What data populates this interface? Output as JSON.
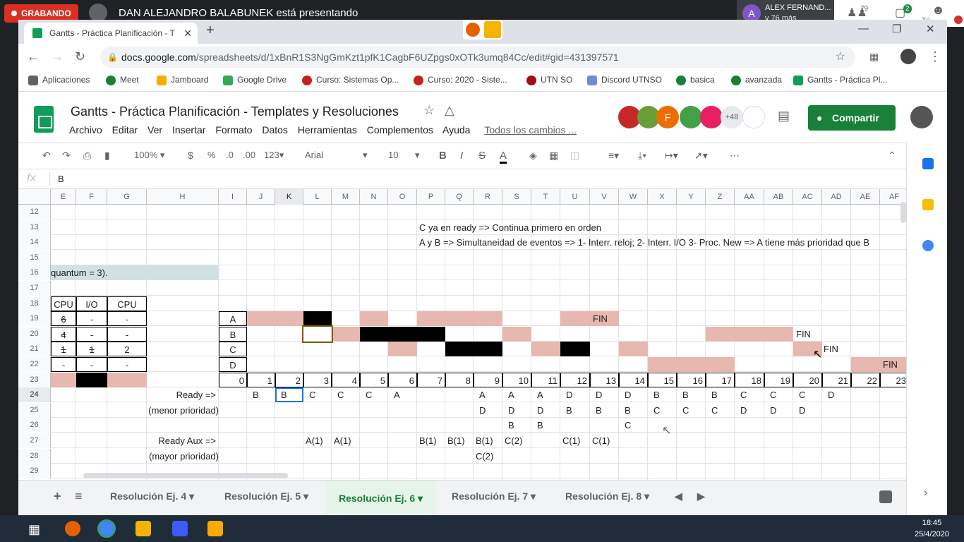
{
  "meet": {
    "recording": "GRABANDO",
    "presenting": "DAN ALEJANDRO BALABUNEK está presentando",
    "participant_name": "ALEX FERNAND...",
    "participant_more": "y 76 más",
    "participant_initial": "A",
    "people_count": "79",
    "chat_count": "2",
    "you_label": "Tú"
  },
  "browser": {
    "tab_title": "Gantts - Práctica Planificación - T",
    "url_host": "docs.google.com",
    "url_path": "/spreadsheets/d/1xBnR1S3NgGmKzt1pfK1CagbF6UZpgs0xOTk3umq84Cc/edit#gid=431397571",
    "bookmarks": [
      "Aplicaciones",
      "Meet",
      "Jamboard",
      "Google Drive",
      "Curso: Sistemas Op...",
      "Curso: 2020 - Siste...",
      "UTN SO",
      "Discord UTNSO",
      "basica",
      "avanzada",
      "Gantts - Práctica Pl..."
    ]
  },
  "doc": {
    "title": "Gantts - Práctica Planificación - Templates y Resoluciones",
    "menu": [
      "Archivo",
      "Editar",
      "Ver",
      "Insertar",
      "Formato",
      "Datos",
      "Herramientas",
      "Complementos",
      "Ayuda"
    ],
    "changes": "Todos los cambios ...",
    "collab_initial": "F",
    "more_collabs": "+48",
    "share": "Compartir"
  },
  "toolbar": {
    "zoom": "100%",
    "currency": "$",
    "percent": "%",
    "dec_less": ".0",
    "dec_more": ".00",
    "format": "123",
    "font": "Arial",
    "size": "10",
    "bold": "B",
    "italic": "I",
    "strike": "S",
    "color": "A"
  },
  "formula": {
    "label": "fx",
    "value": "B"
  },
  "grid": {
    "columns": [
      "E",
      "F",
      "G",
      "H",
      "I",
      "J",
      "K",
      "L",
      "M",
      "N",
      "O",
      "P",
      "Q",
      "R",
      "S",
      "T",
      "U",
      "V",
      "W",
      "X",
      "Y",
      "Z",
      "AA",
      "AB",
      "AC",
      "AD",
      "AE",
      "AF"
    ],
    "rows": [
      "12",
      "13",
      "14",
      "15",
      "16",
      "17",
      "18",
      "19",
      "20",
      "21",
      "22",
      "23",
      "24",
      "25",
      "26",
      "27",
      "28",
      "29"
    ],
    "note1": "C ya en ready => Continua primero en orden",
    "note2": "A y B => Simultaneidad de eventos => 1- Interr. reloj; 2- Interr. I/O 3- Proc. New => A tiene más prioridad que B",
    "quantum": "quantum = 3).",
    "hdr": [
      "CPU",
      "I/O",
      "CPU"
    ],
    "table": [
      [
        "6",
        "-",
        "-"
      ],
      [
        "4",
        "-",
        "-"
      ],
      [
        "1",
        "1",
        "2"
      ],
      [
        "-",
        "-",
        "-"
      ]
    ],
    "procs": [
      "A",
      "B",
      "C",
      "D"
    ],
    "fin": "FIN",
    "timeline": [
      "0",
      "1",
      "2",
      "3",
      "4",
      "5",
      "6",
      "7",
      "8",
      "9",
      "10",
      "11",
      "12",
      "13",
      "14",
      "15",
      "16",
      "17",
      "18",
      "19",
      "20",
      "21",
      "22",
      "23"
    ],
    "ready_label": "Ready =>",
    "menor": "(menor prioridad)",
    "ready_aux": "Ready Aux =>",
    "mayor": "(mayor prioridad)",
    "r24": [
      "B",
      "B",
      "C",
      "C",
      "C",
      "A",
      "",
      "",
      "",
      "A",
      "A",
      "A",
      "D",
      "D",
      "D",
      "B",
      "B",
      "B",
      "C",
      "C",
      "C",
      "D"
    ],
    "r25": [
      "D",
      "D",
      "D",
      "B",
      "B",
      "B",
      "C",
      "C",
      "C",
      "D",
      "D",
      "D"
    ],
    "r26": [
      "B",
      "B",
      "",
      "",
      "C"
    ],
    "r27": [
      "A(1)",
      "A(1)",
      "",
      "",
      "B(1)",
      "B(1)",
      "B(1)",
      "C(2)",
      "",
      "C(1)",
      "C(1)"
    ],
    "r28": "C(2)"
  },
  "sheets": [
    "Resolución Ej. 4",
    "Resolución Ej. 5",
    "Resolución Ej. 6",
    "Resolución Ej. 7",
    "Resolución Ej. 8"
  ],
  "clock": {
    "time": "18:45",
    "date": "25/4/2020"
  }
}
